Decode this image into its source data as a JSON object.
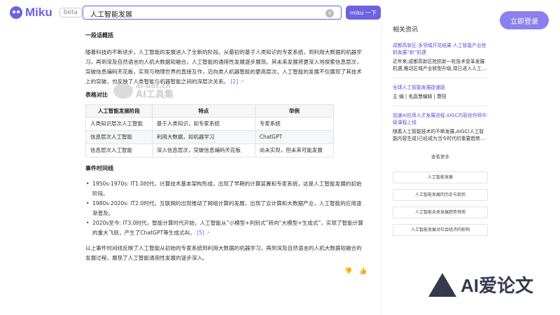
{
  "header": {
    "logo_text": "Miku",
    "beta_label": "beta",
    "search_value": "人工智能发展",
    "clear_glyph": "×",
    "search_button": "miku 一下",
    "login_button": "立即登录"
  },
  "colors": {
    "accent": "#6c63e0",
    "login": "#8b80ee"
  },
  "main": {
    "summary_heading": "一段话概括",
    "summary_text": "随着科技的不断进步，人工智能的发展进入了全新的阶段。从最初的基于人类知识的专家系统，到利用大数据的机器学习，再到深及自然语言的人机大数据软融合，人工智能的通用性发展逐步展现。其未来发展将更深入地探索信息层次，突破信息编码天花板，实现与物理世界的直接互作，迈向类人机器智能的更高层次。人工智能的发展不仅展现了其技术上的突破，也反映了人类智能与机器智能之间的深层次关系。",
    "summary_cite": "[2]",
    "table_heading": "表格对比",
    "table": {
      "headers": [
        "人工智能发展阶段",
        "特点",
        "举例"
      ],
      "rows": [
        [
          "人类知识层次人工智能",
          "基于人类知识，如专家系统",
          "专家系统"
        ],
        [
          "信息层次人工智能",
          "利用大数据，如机器学习",
          "ChatGPT"
        ],
        [
          "信息层次人工智能",
          "深入信息层次，突破信息编码天花板",
          "尚未实现，但未来可能发展"
        ]
      ]
    },
    "timeline_heading": "事件时间线",
    "events": [
      {
        "text": "1950s-1970s: IT1.0时代，计算技术基本架构形成，出现了早期的计算装置和专家系统，这是人工智能发展的初始阶段。",
        "cite": ""
      },
      {
        "text": "1980s-2020s: IT2.0时代，互联网的出现推动了网络计算的发展，出现了云计算和大数据产业，人工智能的应用逐渐普及。",
        "cite": ""
      },
      {
        "text": "2020s至今: IT3.0时代，智能计算时代开始，人工智能从“小模型+判别式”转向“大模型+生成式”，实现了智能计算的重大飞跃，产生了ChatGPT等生成式AI。",
        "cite": "[5]"
      }
    ],
    "conclusion": "以上事件时间线反映了人工智能从初始的专家系统到利用大数据的机器学习，再到深及自然语言的人机大数据软融合的发展过程，展现了人工智能通用性发展的逐步深入。",
    "watermark_top": "ai-bot.cn",
    "watermark_bottom": "AI工具集"
  },
  "sidebar": {
    "title": "相关资讯",
    "news": [
      {
        "title": "成都高新区:多领域开花结果 人工智能产业抢抓发展“新”机遇",
        "body": "近年来,成都高新区抢抓新一轮技术变革发展机遇,推动区域产业转型升级,现已进入人工…"
      },
      {
        "title": "全球人工智能发展提速路",
        "body": "主 编 | 毛晶慧编辑 | 曹阳"
      },
      {
        "title": "加速AI应用人才发展进程 AIGC内容创作师中级课程上线",
        "body": "随着人工智能技术的不断发展,AIGC(人工智能内容生成)已经成为当今时代的重要趋势…"
      }
    ],
    "see_more": "查看更多",
    "related": [
      "人工智能发展",
      "人工智能发展的历史与现状",
      "人工智能未来发展趋势预测",
      "人工智能发展对社会经济的影响"
    ]
  },
  "brand_watermark": "AI爱论文"
}
